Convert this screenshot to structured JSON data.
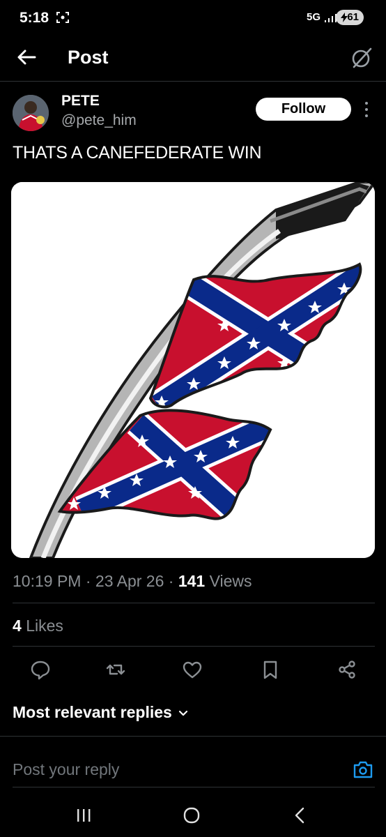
{
  "status_bar": {
    "time": "5:18",
    "network": "5G",
    "battery": "61"
  },
  "header": {
    "title": "Post"
  },
  "post": {
    "author_name": "PETE",
    "author_handle": "@pete_him",
    "follow_label": "Follow",
    "text": "THATS A CANEFEDERATE WIN",
    "time": "10:19 PM",
    "date": "23 Apr 26",
    "views_count": "141",
    "views_label": "Views",
    "likes_count": "4",
    "likes_label": "Likes"
  },
  "actions": [
    "reply-icon",
    "repost-icon",
    "like-icon",
    "bookmark-icon",
    "share-icon"
  ],
  "replies": {
    "sort_label": "Most relevant replies"
  },
  "reply_box": {
    "placeholder": "Post your reply"
  },
  "colors": {
    "background": "#000000",
    "accent": "#1d9bf0",
    "flag_red": "#c8102e",
    "flag_blue": "#0a2a8a"
  }
}
